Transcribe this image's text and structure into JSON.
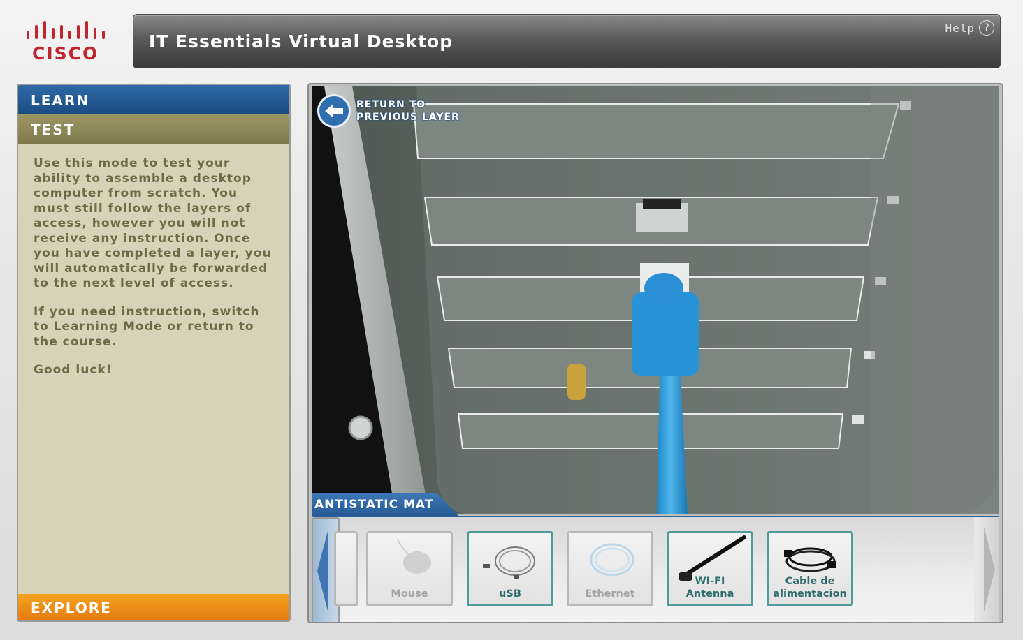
{
  "brand": {
    "logo_text": "CISCO",
    "logo_color": "#c0262d"
  },
  "header": {
    "title": "IT Essentials Virtual Desktop",
    "help_label": "Help",
    "help_icon": "question-circle-icon"
  },
  "modes": {
    "learn": "LEARN",
    "test": "TEST",
    "explore": "EXPLORE"
  },
  "instructions": [
    "Use this mode to test your ability to assemble a desktop computer from scratch. You must still follow the layers of access, however you will not receive any instruction. Once you have completed a layer, you will automatically be forwarded to the next level of access.",
    "If you need instruction, switch to Learning Mode or return to the course.",
    "Good luck!"
  ],
  "scene": {
    "return_line1": "RETURN TO",
    "return_line2": "PREVIOUS LAYER",
    "mat_label": "ANTISTATIC MAT"
  },
  "tray": {
    "items": [
      {
        "label": "Mouse",
        "icon": "mouse-icon",
        "state": "used"
      },
      {
        "label": "uSB",
        "icon": "usb-cable-icon",
        "state": "available"
      },
      {
        "label": "Ethernet",
        "icon": "ethernet-cable-icon",
        "state": "used"
      },
      {
        "label_line1": "WI-FI",
        "label_line2": "Antenna",
        "icon": "wifi-antenna-icon",
        "state": "available"
      },
      {
        "label_line1": "Cable de",
        "label_line2": "alimentacion",
        "icon": "power-cable-icon",
        "state": "available"
      }
    ]
  },
  "colors": {
    "learn": "#1d4b82",
    "test": "#7f784d",
    "explore": "#e57b10",
    "accent": "#2d64a0"
  }
}
